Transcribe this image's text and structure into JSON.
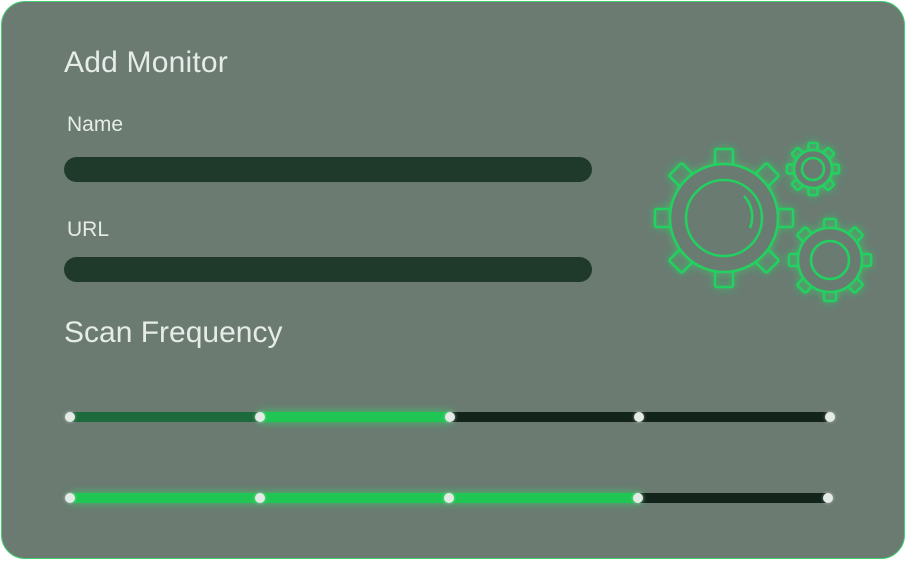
{
  "form": {
    "title": "Add Monitor",
    "name_label": "Name",
    "name_value": "",
    "url_label": "URL",
    "url_value": ""
  },
  "scan": {
    "title": "Scan Frequency",
    "slider_1": {
      "stops": 5,
      "range_start": 0.25,
      "range_end": 0.5
    },
    "slider_2": {
      "stops": 5,
      "value": 0.75
    }
  },
  "illustration": {
    "icon": "gears-icon"
  },
  "colors": {
    "accent": "#20c653",
    "card_background": "#6b7b72",
    "field_background": "#1f3a2b",
    "track_background": "#12231a",
    "border": "#3fd16f"
  }
}
